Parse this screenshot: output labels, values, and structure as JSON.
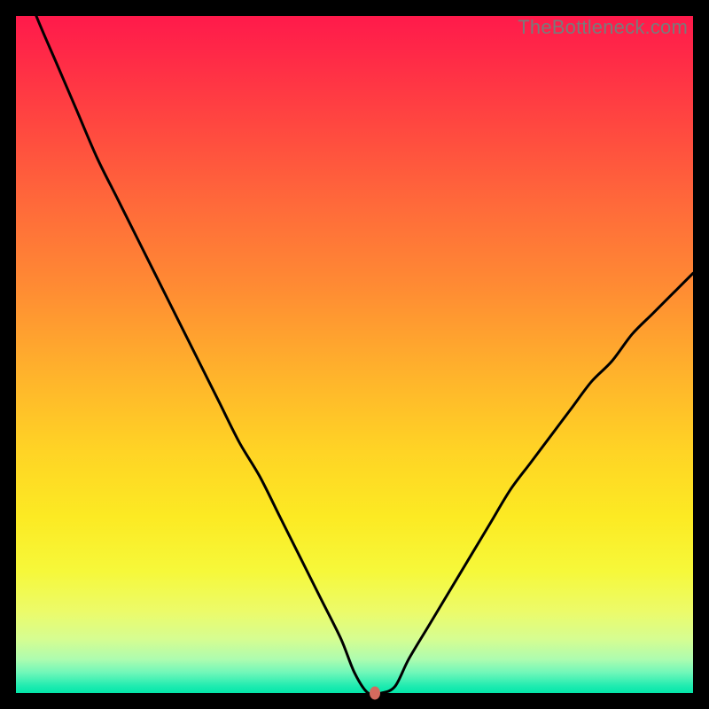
{
  "watermark": "TheBottleneck.com",
  "chart_data": {
    "type": "line",
    "title": "",
    "xlabel": "",
    "ylabel": "",
    "xlim": [
      0,
      100
    ],
    "ylim": [
      0,
      100
    ],
    "x": [
      0,
      3,
      6,
      9,
      12,
      15,
      18,
      21,
      24,
      27,
      30,
      33,
      36,
      39,
      42,
      45,
      48,
      50,
      52,
      54,
      56,
      58,
      61,
      64,
      67,
      70,
      73,
      76,
      79,
      82,
      85,
      88,
      91,
      94,
      97,
      100
    ],
    "values": [
      108,
      100,
      93,
      86,
      79,
      73,
      67,
      61,
      55,
      49,
      43,
      37,
      32,
      26,
      20,
      14,
      8,
      3,
      0,
      0,
      1,
      5,
      10,
      15,
      20,
      25,
      30,
      34,
      38,
      42,
      46,
      49,
      53,
      56,
      59,
      62
    ],
    "marker": {
      "x": 53,
      "y": 0
    },
    "background_gradient": {
      "top": "#ff1a4b",
      "mid": "#ffd325",
      "bottom": "#03e6a9"
    }
  }
}
